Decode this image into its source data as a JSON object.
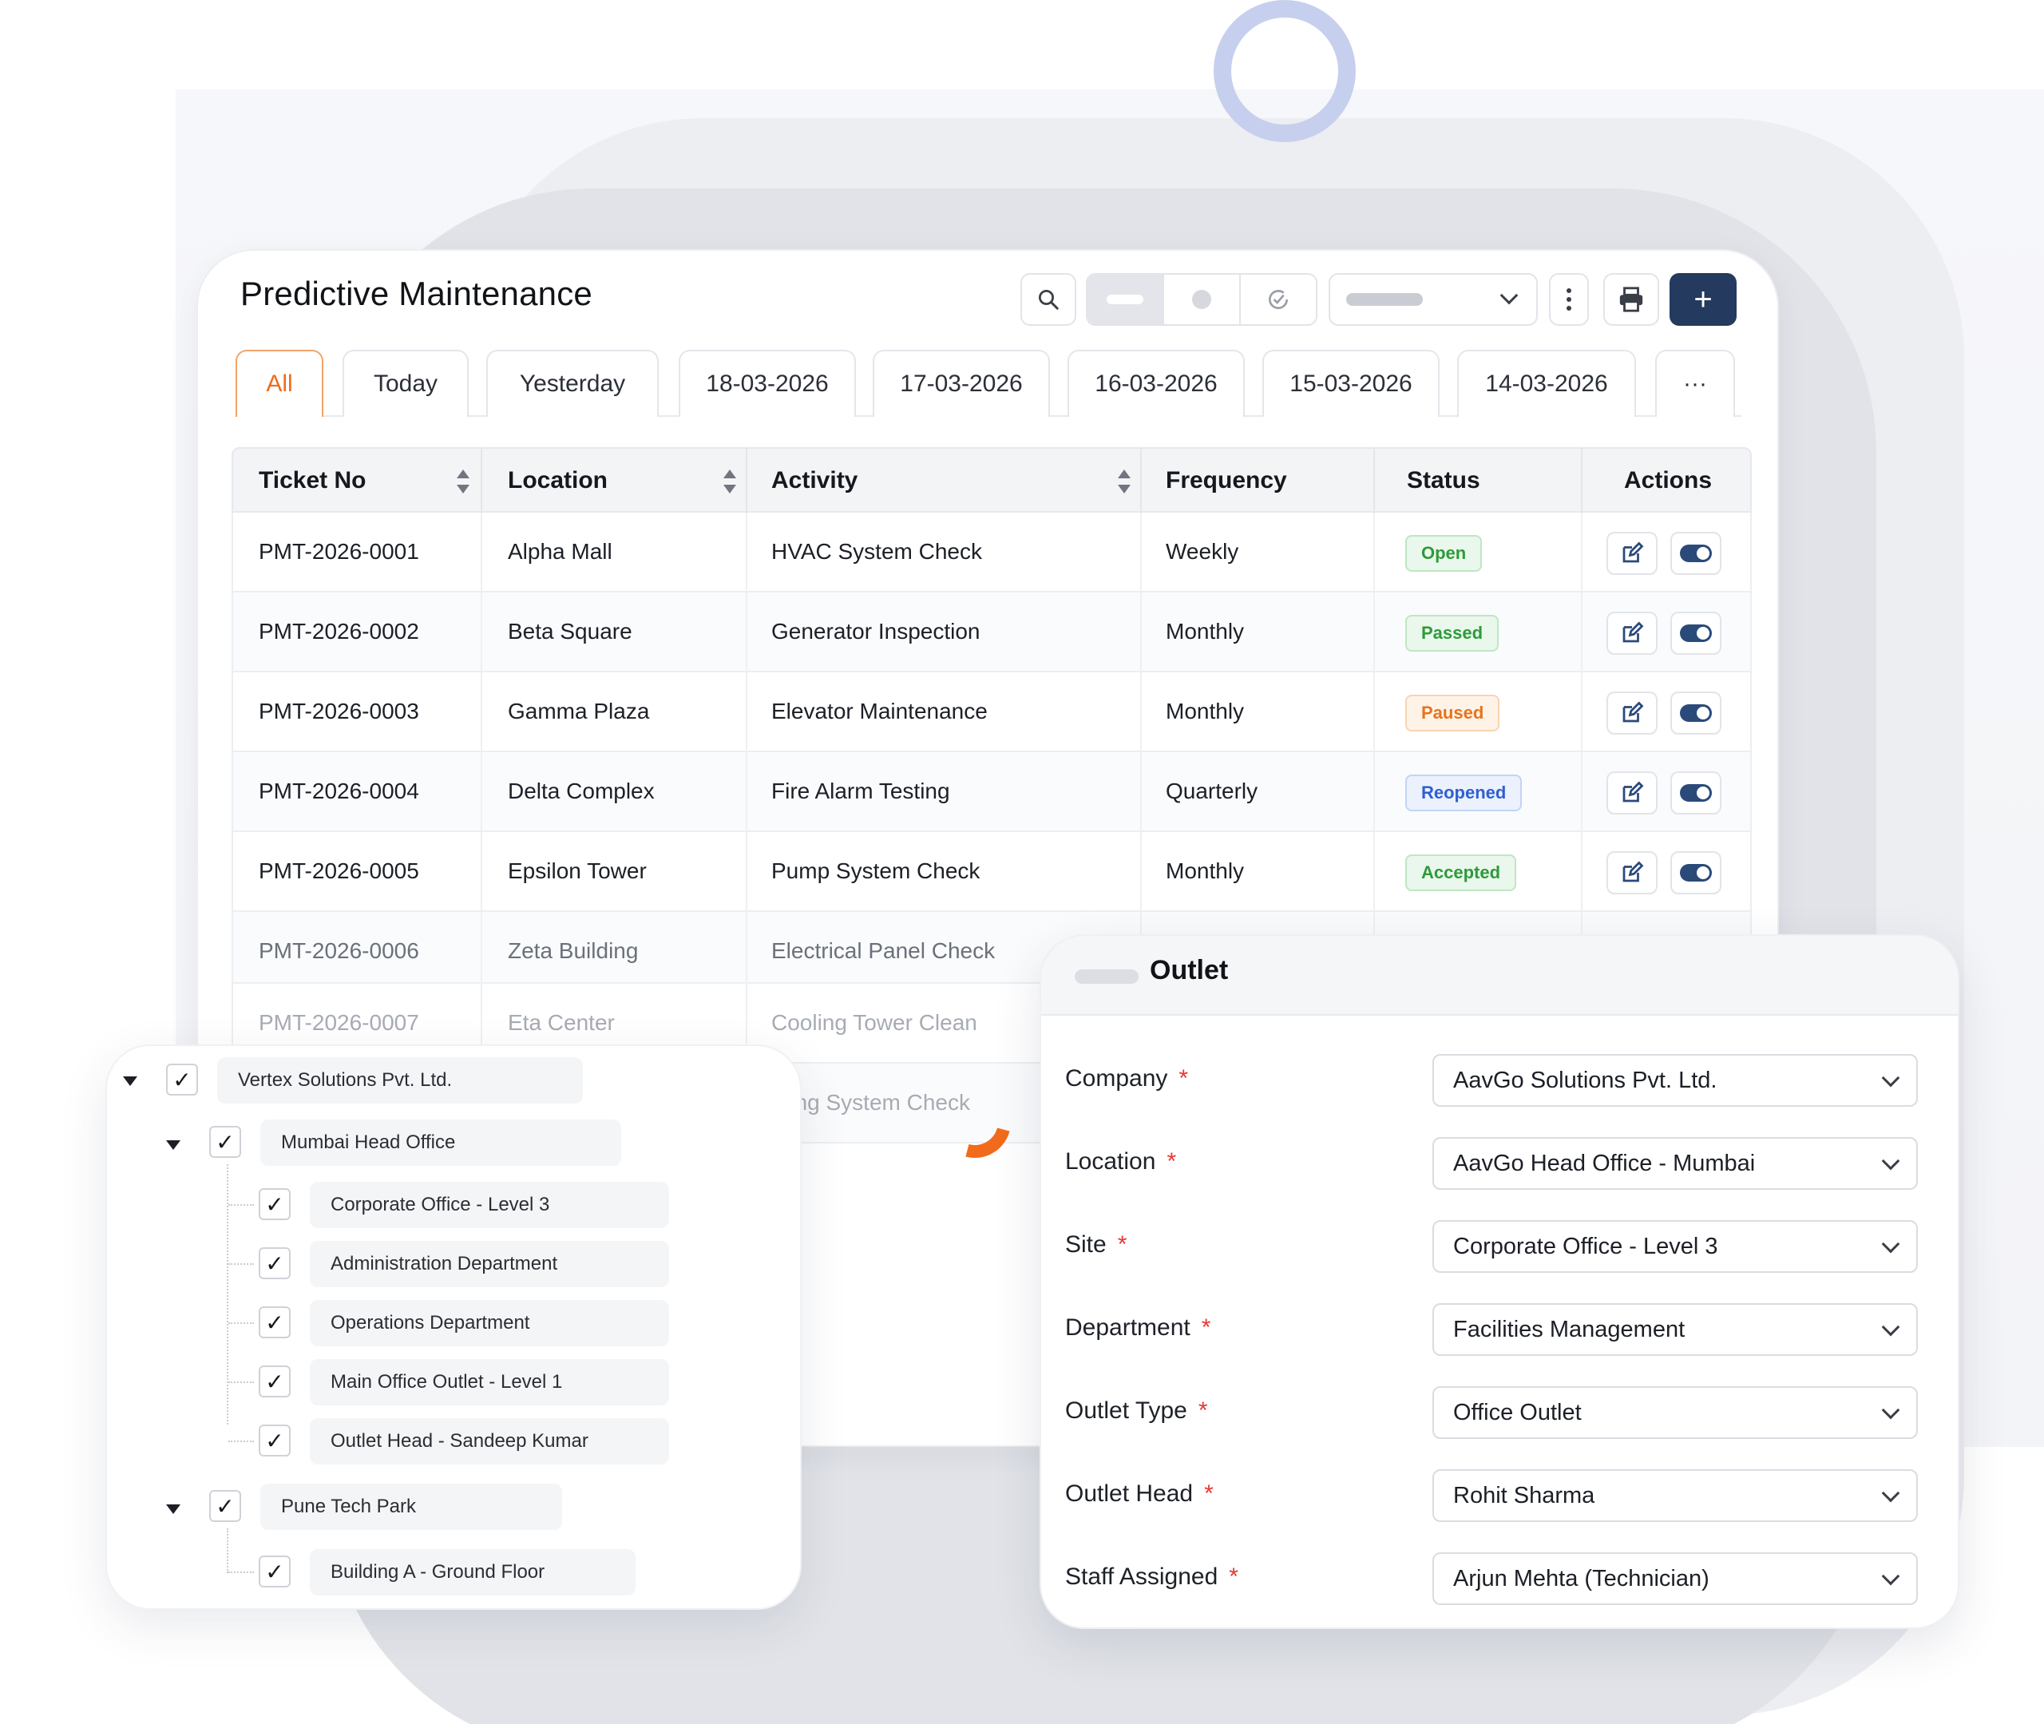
{
  "header": {
    "title": "Predictive Maintenance",
    "add_label": "+"
  },
  "tabs": [
    "All",
    "Today",
    "Yesterday",
    "18-03-2026",
    "17-03-2026",
    "16-03-2026",
    "15-03-2026",
    "14-03-2026",
    "···"
  ],
  "table": {
    "columns": [
      "Ticket No",
      "Location",
      "Activity",
      "Frequency",
      "Status",
      "Actions"
    ],
    "rows": [
      {
        "ticket": "PMT-2026-0001",
        "location": "Alpha Mall",
        "activity": "HVAC System Check",
        "frequency": "Weekly",
        "status": "Open"
      },
      {
        "ticket": "PMT-2026-0002",
        "location": "Beta Square",
        "activity": "Generator Inspection",
        "frequency": "Monthly",
        "status": "Passed"
      },
      {
        "ticket": "PMT-2026-0003",
        "location": "Gamma Plaza",
        "activity": "Elevator Maintenance",
        "frequency": "Monthly",
        "status": "Paused"
      },
      {
        "ticket": "PMT-2026-0004",
        "location": "Delta Complex",
        "activity": "Fire Alarm Testing",
        "frequency": "Quarterly",
        "status": "Reopened"
      },
      {
        "ticket": "PMT-2026-0005",
        "location": "Epsilon Tower",
        "activity": "Pump System Check",
        "frequency": "Monthly",
        "status": "Accepted"
      },
      {
        "ticket": "PMT-2026-0006",
        "location": "Zeta Building",
        "activity": "Electrical Panel Check",
        "frequency": "",
        "status": ""
      },
      {
        "ticket": "PMT-2026-0007",
        "location": "Eta Center",
        "activity": "Cooling Tower Clean",
        "frequency": "",
        "status": ""
      },
      {
        "ticket": "",
        "location": "",
        "activity": "nting System Check",
        "frequency": "",
        "status": ""
      }
    ]
  },
  "status_colors": {
    "Open": {
      "fg": "#2e9a3a",
      "bg": "#eaf7ec",
      "border": "#bfe6c4"
    },
    "Passed": {
      "fg": "#2e9a3a",
      "bg": "#eaf7ec",
      "border": "#bfe6c4"
    },
    "Paused": {
      "fg": "#e8731c",
      "bg": "#fff3e8",
      "border": "#f8d3b2"
    },
    "Reopened": {
      "fg": "#2f5fd0",
      "bg": "#ebf1fd",
      "border": "#c3d4f6"
    },
    "Accepted": {
      "fg": "#2e9a3a",
      "bg": "#eaf7ec",
      "border": "#bfe6c4"
    }
  },
  "tree": {
    "root": "Vertex Solutions Pvt. Ltd.",
    "groups": [
      {
        "label": "Mumbai Head Office",
        "children": [
          "Corporate Office - Level 3",
          "Administration Department",
          "Operations Department",
          "Main Office Outlet - Level 1",
          "Outlet Head - Sandeep Kumar"
        ]
      },
      {
        "label": "Pune Tech Park",
        "children": [
          "Building A - Ground Floor"
        ]
      }
    ]
  },
  "outlet": {
    "title": "Outlet",
    "fields": [
      {
        "label": "Company",
        "value": "AavGo Solutions Pvt. Ltd."
      },
      {
        "label": "Location",
        "value": "AavGo Head Office - Mumbai"
      },
      {
        "label": "Site",
        "value": "Corporate Office - Level 3"
      },
      {
        "label": "Department",
        "value": "Facilities Management"
      },
      {
        "label": "Outlet Type",
        "value": "Office Outlet"
      },
      {
        "label": "Outlet Head",
        "value": "Rohit Sharma"
      },
      {
        "label": "Staff Assigned",
        "value": "Arjun Mehta (Technician)"
      }
    ],
    "required_mark": "*"
  },
  "colors": {
    "accent": "#ef6c1a",
    "primary_button": "#243a5e",
    "ring": "#c7cfee"
  }
}
